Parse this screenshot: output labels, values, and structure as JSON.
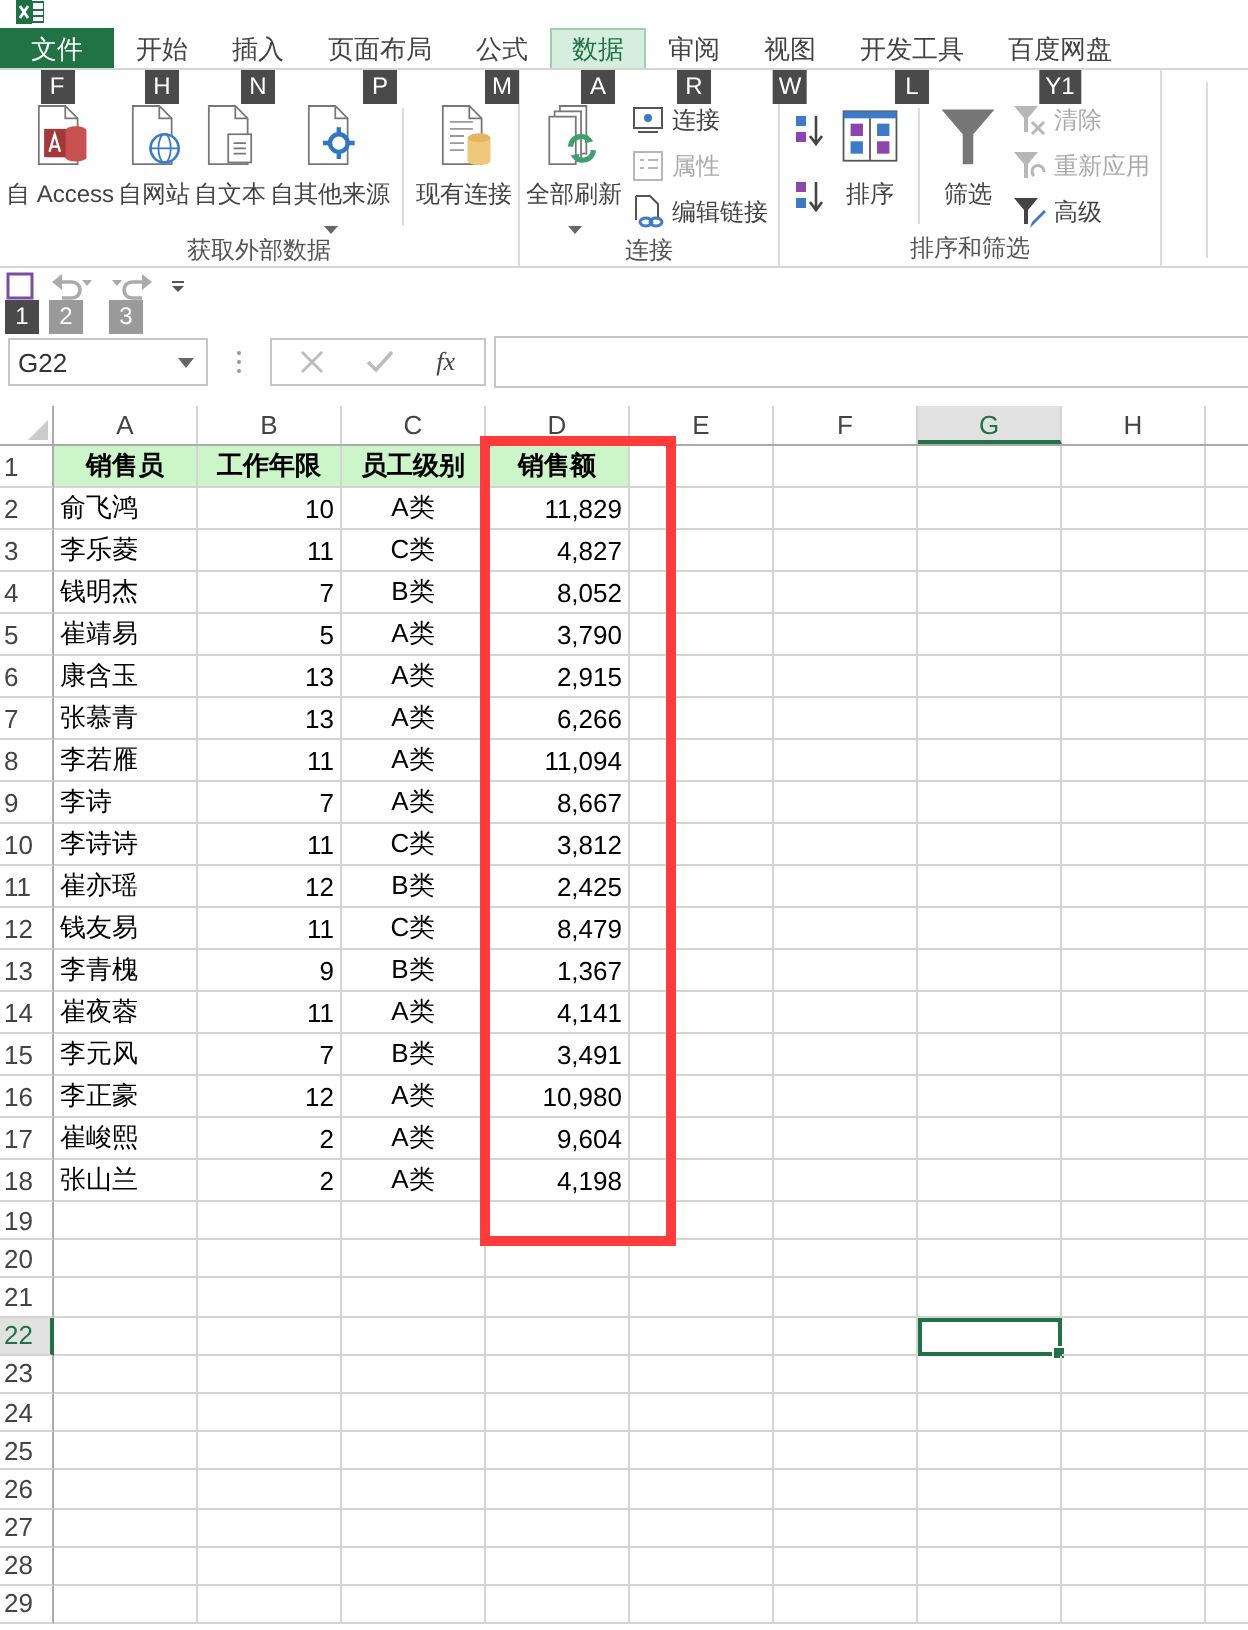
{
  "tabs": [
    {
      "label": "文件",
      "kind": "file",
      "selected": false,
      "keytip": "F"
    },
    {
      "label": "开始",
      "kind": "tab",
      "selected": false,
      "keytip": "H"
    },
    {
      "label": "插入",
      "kind": "tab",
      "selected": false,
      "keytip": "N"
    },
    {
      "label": "页面布局",
      "kind": "tab",
      "selected": false,
      "keytip": "P"
    },
    {
      "label": "公式",
      "kind": "tab",
      "selected": false,
      "keytip": "M"
    },
    {
      "label": "数据",
      "kind": "tab",
      "selected": true,
      "keytip": "A"
    },
    {
      "label": "审阅",
      "kind": "tab",
      "selected": false,
      "keytip": "R"
    },
    {
      "label": "视图",
      "kind": "tab",
      "selected": false,
      "keytip": "W"
    },
    {
      "label": "开发工具",
      "kind": "tab",
      "selected": false,
      "keytip": "L"
    },
    {
      "label": "百度网盘",
      "kind": "tab",
      "selected": false,
      "keytip": "Y1"
    }
  ],
  "ribbon": {
    "groups": [
      {
        "label": "获取外部数据",
        "items": [
          {
            "kind": "large",
            "label": "自 Access",
            "dropdown": false
          },
          {
            "kind": "large",
            "label": "自网站",
            "dropdown": false
          },
          {
            "kind": "large",
            "label": "自文本",
            "dropdown": false
          },
          {
            "kind": "large",
            "label": "自其他来源",
            "dropdown": true
          },
          {
            "kind": "separator"
          },
          {
            "kind": "large",
            "label": "现有连接",
            "dropdown": false
          }
        ]
      },
      {
        "label": "连接",
        "items": [
          {
            "kind": "large",
            "label": "全部刷新",
            "dropdown": true
          },
          {
            "kind": "stack",
            "items": [
              {
                "label": "连接",
                "disabled": false
              },
              {
                "label": "属性",
                "disabled": true
              },
              {
                "label": "编辑链接",
                "disabled": false
              }
            ]
          }
        ]
      },
      {
        "label": "排序和筛选",
        "items": [
          {
            "kind": "stack",
            "items": [
              {
                "disabled": false
              },
              {
                "disabled": false
              }
            ]
          },
          {
            "kind": "large",
            "label": "排序",
            "dropdown": false
          },
          {
            "kind": "separator"
          },
          {
            "kind": "large",
            "label": "筛选",
            "dropdown": false
          },
          {
            "kind": "stack",
            "items": [
              {
                "label": "清除",
                "disabled": true
              },
              {
                "label": "重新应用",
                "disabled": true
              },
              {
                "label": "高级",
                "disabled": false
              }
            ]
          }
        ]
      }
    ]
  },
  "quick_access": [
    {
      "kind": "save",
      "keytip": "1"
    },
    {
      "kind": "undo",
      "keytip": "2",
      "disabled": true
    },
    {
      "kind": "redo",
      "keytip": "3",
      "disabled": true
    },
    {
      "kind": "customize"
    }
  ],
  "formula_bar": {
    "name_box": "G22",
    "function_label": "fx"
  },
  "sheet": {
    "columns": [
      {
        "label": "A",
        "selected": false
      },
      {
        "label": "B",
        "selected": false
      },
      {
        "label": "C",
        "selected": false
      },
      {
        "label": "D",
        "selected": false
      },
      {
        "label": "E",
        "selected": false
      },
      {
        "label": "F",
        "selected": false
      },
      {
        "label": "G",
        "selected": true
      },
      {
        "label": "H",
        "selected": false
      }
    ],
    "rows": [
      {
        "number": "1",
        "kind": "header",
        "selected": false,
        "cells": [
          "销售员",
          "工作年限",
          "员工级别",
          "销售额"
        ]
      },
      {
        "number": "2",
        "kind": "data",
        "selected": false,
        "cells": [
          "俞飞鸿",
          "10",
          "A类",
          "11,829"
        ]
      },
      {
        "number": "3",
        "kind": "data",
        "selected": false,
        "cells": [
          "李乐菱",
          "11",
          "C类",
          "4,827"
        ]
      },
      {
        "number": "4",
        "kind": "data",
        "selected": false,
        "cells": [
          "钱明杰",
          "7",
          "B类",
          "8,052"
        ]
      },
      {
        "number": "5",
        "kind": "data",
        "selected": false,
        "cells": [
          "崔靖易",
          "5",
          "A类",
          "3,790"
        ]
      },
      {
        "number": "6",
        "kind": "data",
        "selected": false,
        "cells": [
          "康含玉",
          "13",
          "A类",
          "2,915"
        ]
      },
      {
        "number": "7",
        "kind": "data",
        "selected": false,
        "cells": [
          "张慕青",
          "13",
          "A类",
          "6,266"
        ]
      },
      {
        "number": "8",
        "kind": "data",
        "selected": false,
        "cells": [
          "李若雁",
          "11",
          "A类",
          "11,094"
        ]
      },
      {
        "number": "9",
        "kind": "data",
        "selected": false,
        "cells": [
          "李诗",
          "7",
          "A类",
          "8,667"
        ]
      },
      {
        "number": "10",
        "kind": "data",
        "selected": false,
        "cells": [
          "李诗诗",
          "11",
          "C类",
          "3,812"
        ]
      },
      {
        "number": "11",
        "kind": "data",
        "selected": false,
        "cells": [
          "崔亦瑶",
          "12",
          "B类",
          "2,425"
        ]
      },
      {
        "number": "12",
        "kind": "data",
        "selected": false,
        "cells": [
          "钱友易",
          "11",
          "C类",
          "8,479"
        ]
      },
      {
        "number": "13",
        "kind": "data",
        "selected": false,
        "cells": [
          "李青槐",
          "9",
          "B类",
          "1,367"
        ]
      },
      {
        "number": "14",
        "kind": "data",
        "selected": false,
        "cells": [
          "崔夜蓉",
          "11",
          "A类",
          "4,141"
        ]
      },
      {
        "number": "15",
        "kind": "data",
        "selected": false,
        "cells": [
          "李元风",
          "7",
          "B类",
          "3,491"
        ]
      },
      {
        "number": "16",
        "kind": "data",
        "selected": false,
        "cells": [
          "李正豪",
          "12",
          "A类",
          "10,980"
        ]
      },
      {
        "number": "17",
        "kind": "data",
        "selected": false,
        "cells": [
          "崔峻熙",
          "2",
          "A类",
          "9,604"
        ]
      },
      {
        "number": "18",
        "kind": "data",
        "selected": false,
        "cells": [
          "张山兰",
          "2",
          "A类",
          "4,198"
        ]
      },
      {
        "number": "19",
        "kind": "empty",
        "selected": false
      },
      {
        "number": "20",
        "kind": "empty",
        "selected": false
      },
      {
        "number": "21",
        "kind": "empty",
        "selected": false
      },
      {
        "number": "22",
        "kind": "empty",
        "selected": true
      },
      {
        "number": "23",
        "kind": "empty",
        "selected": false
      },
      {
        "number": "24",
        "kind": "empty",
        "selected": false
      },
      {
        "number": "25",
        "kind": "empty",
        "selected": false
      },
      {
        "number": "26",
        "kind": "empty",
        "selected": false
      },
      {
        "number": "27",
        "kind": "empty",
        "selected": false
      },
      {
        "number": "28",
        "kind": "empty",
        "selected": false
      },
      {
        "number": "29",
        "kind": "empty",
        "selected": false
      }
    ]
  }
}
